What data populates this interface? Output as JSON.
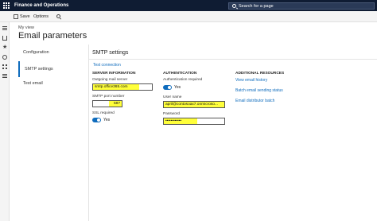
{
  "app": {
    "title": "Finance and Operations"
  },
  "search": {
    "placeholder": "Search for a page"
  },
  "toolbar": {
    "save_label": "Save",
    "options_label": "Options"
  },
  "header": {
    "breadcrumb": "My view",
    "page_title": "Email parameters"
  },
  "tabs": [
    {
      "label": "Configuration",
      "active": false
    },
    {
      "label": "SMTP settings",
      "active": true
    },
    {
      "label": "Test email",
      "active": false
    }
  ],
  "main": {
    "section_title": "SMTP settings",
    "test_connection": "Test connection",
    "server": {
      "heading": "SERVER INFORMATION",
      "outgoing_label": "Outgoing mail server",
      "outgoing_value": "smtp.office365.com",
      "port_label": "SMTP port number",
      "port_value": "587",
      "ssl_label": "SSL required",
      "ssl_value": "Yes"
    },
    "auth": {
      "heading": "AUTHENTICATION",
      "required_label": "Authentication required",
      "required_value": "Yes",
      "username_label": "User name",
      "username_value": "april@contosoax7.onmicroso...",
      "password_label": "Password",
      "password_value": "••••••••••••"
    },
    "resources": {
      "heading": "ADDITIONAL RESOURCES",
      "links": [
        "View email history",
        "Batch email sending status",
        "Email distributor batch"
      ]
    }
  },
  "colors": {
    "accent": "#0f6cbd",
    "topbar": "#0f1c33",
    "highlight": "#ffff3a"
  }
}
